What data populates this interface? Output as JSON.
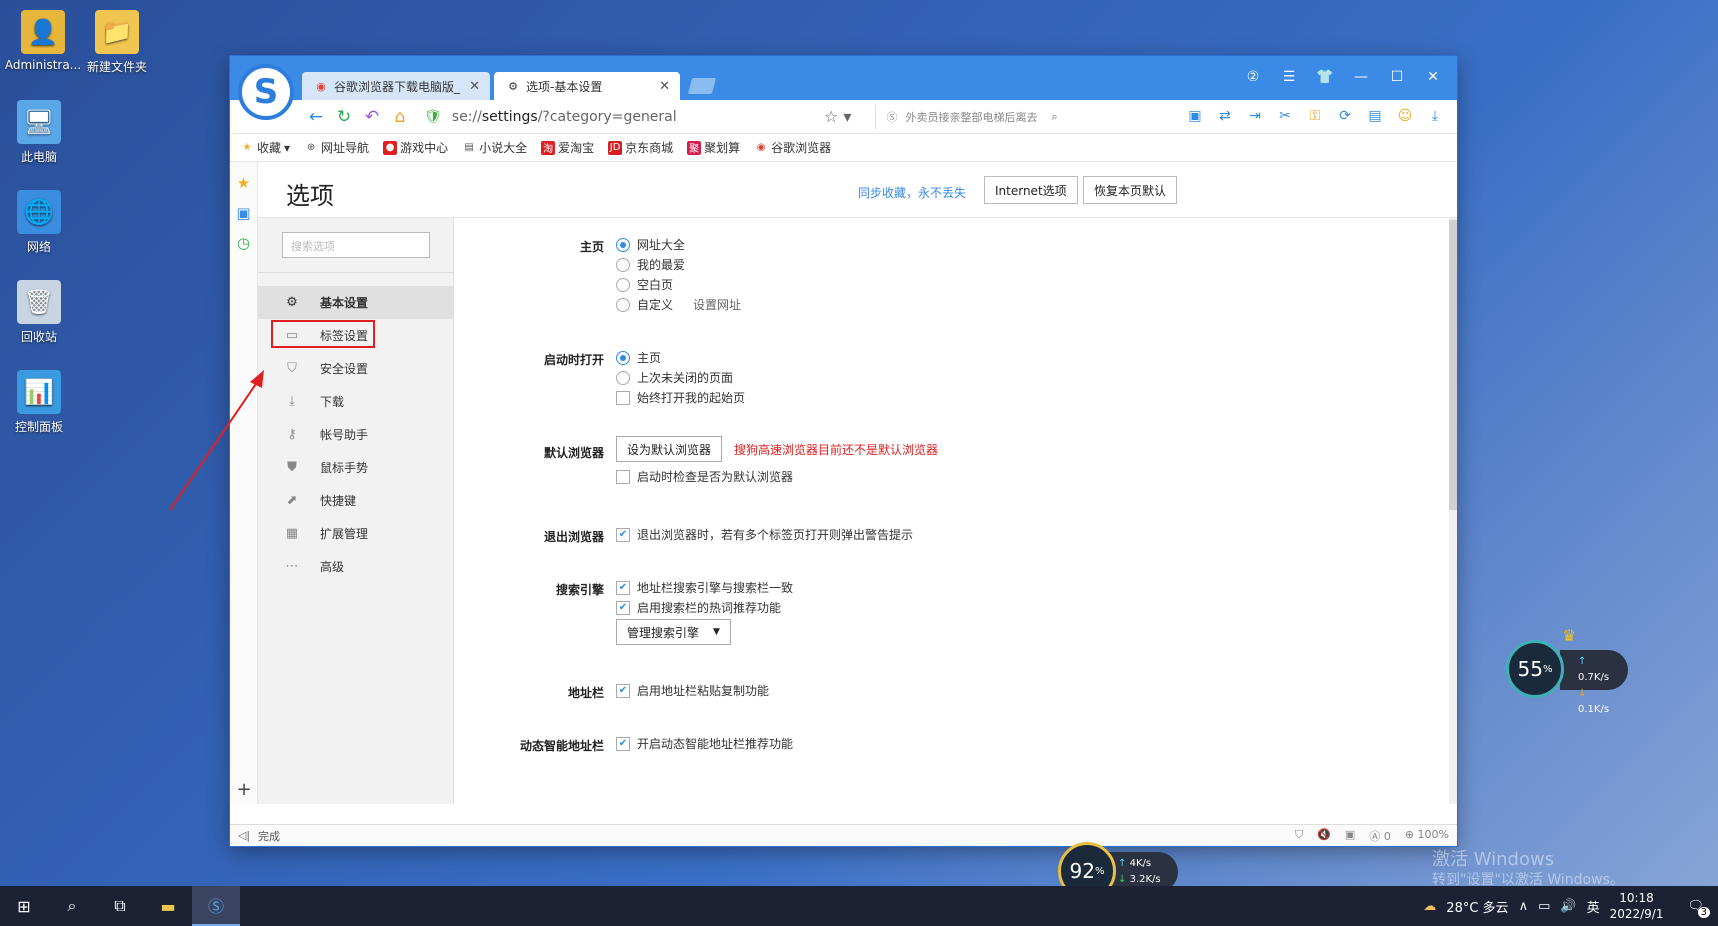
{
  "desktop": {
    "icons": [
      {
        "label": "Administra..."
      },
      {
        "label": "新建文件夹"
      },
      {
        "label": "此电脑"
      },
      {
        "label": "网络"
      },
      {
        "label": "回收站"
      },
      {
        "label": "控制面板"
      }
    ]
  },
  "browser": {
    "tabs": [
      {
        "label": "谷歌浏览器下载电脑版_"
      },
      {
        "label": "选项-基本设置"
      }
    ],
    "url_prefix": "se://",
    "url_main": "settings",
    "url_suffix": "/?category=general",
    "search_placeholder": "外卖员接亲整部电梯后离去",
    "bookmarks": [
      {
        "label": "收藏"
      },
      {
        "label": "网址导航"
      },
      {
        "label": "游戏中心"
      },
      {
        "label": "小说大全"
      },
      {
        "label": "爱淘宝"
      },
      {
        "label": "京东商城"
      },
      {
        "label": "聚划算"
      },
      {
        "label": "谷歌浏览器"
      }
    ],
    "status": "完成",
    "zoom": "100%",
    "ad_count": "0"
  },
  "options": {
    "title": "选项",
    "sync_link": "同步收藏，永不丢失",
    "internet_options": "Internet选项",
    "restore_default": "恢复本页默认",
    "search_placeholder": "搜索选项",
    "nav": [
      {
        "label": "基本设置"
      },
      {
        "label": "标签设置"
      },
      {
        "label": "安全设置"
      },
      {
        "label": "下载"
      },
      {
        "label": "帐号助手"
      },
      {
        "label": "鼠标手势"
      },
      {
        "label": "快捷键"
      },
      {
        "label": "扩展管理"
      },
      {
        "label": "高级"
      }
    ],
    "homepage": {
      "label": "主页",
      "choices": [
        "网址大全",
        "我的最爱",
        "空白页",
        "自定义"
      ],
      "set_url": "设置网址"
    },
    "startup": {
      "label": "启动时打开",
      "choices": [
        "主页",
        "上次未关闭的页面"
      ],
      "always_open": "始终打开我的起始页"
    },
    "default_browser": {
      "label": "默认浏览器",
      "button": "设为默认浏览器",
      "warning": "搜狗高速浏览器目前还不是默认浏览器",
      "check_on_start": "启动时检查是否为默认浏览器"
    },
    "exit_browser": {
      "label": "退出浏览器",
      "warn_multi": "退出浏览器时，若有多个标签页打开则弹出警告提示"
    },
    "search_engine": {
      "label": "搜索引擎",
      "sync": "地址栏搜索引擎与搜索栏一致",
      "hot_words": "启用搜索栏的热词推荐功能",
      "manage": "管理搜索引擎"
    },
    "address_bar": {
      "label": "地址栏",
      "paste_copy": "启用地址栏粘贴复制功能"
    },
    "smart_address": {
      "label": "动态智能地址栏",
      "recommend": "开启动态智能地址栏推荐功能"
    }
  },
  "widgets": {
    "cpu_percent": "55",
    "cpu_up": "0.7K/s",
    "cpu_down": "0.1K/s",
    "mem_percent": "92",
    "mem_up": "4K/s",
    "mem_down": "3.2K/s"
  },
  "watermark": {
    "line1": "激活 Windows",
    "line2": "转到\"设置\"以激活 Windows。"
  },
  "taskbar": {
    "weather": "28°C 多云",
    "ime": "英",
    "time": "10:18",
    "date": "2022/9/1",
    "notifications": "3"
  }
}
